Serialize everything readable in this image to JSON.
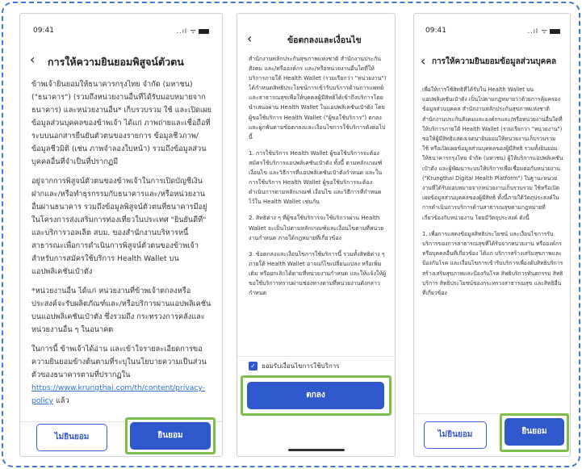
{
  "screen1": {
    "time": "09:41",
    "signal": "..ıl ᯤ",
    "title": "การให้ความยินยอมพิสูจน์ตัวตน",
    "paragraphs": [
      "ข้าพเจ้ายินยอมให้ธนาคารกรุงไทย จำกัด (มหาชน) (\"ธนาคาร\") (รวมถึงหน่วยงานอื่นที่ได้รับมอบหมายจากธนาคาร) และหน่วยงานอื่น* เก็บรวบรวม ใช้ และเปิดเผยข้อมูลส่วนบุคคลของข้าพเจ้า ได้แก่ ภาพถ่ายและเชื่อถือที่ระบบนอกสารยืนยันตัวตนของรายการ ข้อมูลชีวภาพ/ข้อมูลชีวมิติ (เช่น ภาพจำลองใบหน้า) รวมถึงข้อมูลส่วนบุคคลอื่นที่จำเป็นที่ปรากฏมี",
      "อยู่จากการพิสูจน์ตัวตนของข้าพเจ้าในการเปิดบัญชีเงินฝากและ/หรือทำธุรกรรมกับธนาคารและ/หรือหน่วยงานอื่นผ่านธนาคาร รวมถึงข้อมูลพิสูจน์ตัวตนที่ธนาคารมีอยู่ในโครงการส่งเสริมการท่องเที่ยวในประเทศ \"ยินยันดีที่\" และบริการวอลเล็ต สบม. ของสำนักงานบริหารหนี้สาธารณะเพื่อการดำเนินการพิสูจน์ตัวตนของข้าพเจ้าสำหรับการสมัครใช้บริการ Health Wallet บนแอปพลิเคชันเป๋าตัง",
      "*หน่วยงานอื่น ได้แก่ หน่วยงานที่ข้าพเจ้าตกลงหรือประสงค์จะรับผลิตภัณฑ์และ/หรือบริการผ่านแอปพลิเคชันบนแอปพลิเคชันเป๋าตัง ซึ่งรวมถึง กระทรวงการคลังและหน่วยงานอื่น ๆ ในอนาคต",
      "ในการนี้ ข้าพเจ้าได้อ่าน และเข้าใจรายละเอียดการขอความยินยอมข้างต้นตามที่ระบุในนโยบายความเป็นส่วนตัวของธนาคารตามที่ปรากฏใน"
    ],
    "link": "https://www.krungthai.com/th/content/privacy-policy",
    "link_suffix": " แล้ว",
    "decline_label": "ไม่ยินยอม",
    "accept_label": "ยินยอม"
  },
  "screen2": {
    "title": "ข้อตกลงและเงื่อนไข",
    "paragraphs": [
      "สำนักงานหลักประกันสุขภาพแห่งชาติ สำนักงานประกันสังคม และ/หรือองค์กร และ/หรือหน่วยงานอื่นใดที่ให้บริการภายใต้ Health Wallet (รวมเรียกว่า \"หน่วยงาน\") ได้กำหนดสิทธิประโยชน์การเข้ารับบริการด้านการแพทย์และสาธารณสุขเพื่อให้บุคคลผู้มีสิทธิได้เข้าถึงบริการโดยนำเสนอผ่าน Health Wallet ในแอปพลิเคชันเป๋าตัง โดยผู้ขอใช้บริการ Health Wallet (\"ผู้ขอใช้บริการ\") ตกลงและผูกพันตามข้อตกลงและเงื่อนไขการใช้บริการดังต่อไปนี้",
      "1. การใช้บริการ Health Wallet ผู้ขอใช้บริการจะต้องสมัครใช้บริการแอปพลิเคชันเป๋าตัง ทั้งนี้ ตามหลักเกณฑ์ เงื่อนไข และวิธีการที่แอปพลิเคชันเป๋าตังกำหนด และในการใช้บริการ Health Wallet ผู้ขอใช้บริการจะต้องดำเนินการตามหลักเกณฑ์ เงื่อนไข และวิธีการที่กำหนดไว้ใน Health Wallet เช่นกัน",
      "2. สิทธิต่าง ๆ ที่ผู้ขอใช้บริการจะใช้บริการผ่าน Health Wallet จะเป็นไปตามหลักเกณฑ์และเงื่อนไขตามที่หน่วยงานกำหนด ภายใต้กฎหมายที่เกี่ยวข้อง",
      "3. ข้อตกลงและเงื่อนไขการใช้บริการนี้ รวมทั้งสิทธิต่าง ๆ ภายใต้ Health Wallet อาจแก้ไขเปลี่ยนแปลง หรือเพิ่มเติม หรือยกเลิกได้ตามที่หน่วยงานกำหนด และให้แจ้งให้ผู้ขอใช้บริการทราบผ่านช่องทางตามที่หน่วยงานดังกล่าวกำหนด"
    ],
    "consent_label": "ยอมรับเงื่อนไขการใช้บริการ",
    "ok_label": "ตกลง"
  },
  "screen3": {
    "time": "09:41",
    "signal": "..ıl ᯤ",
    "title": "การให้ความยินยอมข้อมูลส่วนบุคคล",
    "paragraphs": [
      "เพื่อให้การใช้สิทธิที่ได้รับใน Health Wallet บนแอปพลิเคชันเป๋าตัง เป็นไปตามกฎหมายว่าด้วยการคุ้มครองข้อมูลส่วนบุคคล สำนักงานหลักประกันสุขภาพแห่งชาติ สำนักงานประกันสังคมและองค์กรและ/หรือหน่วยงานอื่นใดที่ให้บริการภายใต้ Health Wallet (รวมเรียกว่า \"หน่วยงาน\") ขอให้ผู้มีสิทธิแสดงเจตนายินยอมให้หน่วยงานเก็บรวบรวม ใช้ หรือเปิดเผยข้อมูลส่วนบุคคลของผู้มีสิทธิ รวมทั้งยินยอมให้ธนาคารกรุงไทย จำกัด (มหาชน) ผู้ให้บริการแอปพลิเคชันเป๋าตัง และผู้พัฒนาระบบให้บริการเพื่อเชื่อมต่อกับหน่วยงาน (\"Krungthai Digital Health Platform\") ในฐานะหน่วยงานที่ได้รับมอบหมายจากหน่วยงานเก็บรวบรวม ใช้หรือเปิดเผยข้อมูลส่วนบุคคลของผู้มีสิทธิ ทั้งนี้ภายใต้วัตถุประสงค์ในการดำเนินการบริการด้านสาธารณสุขตามกฎหมายที่เกี่ยวข้องกับหน่วยงาน โดยมีวัตถุประสงค์ ดังนี้",
      "1. เพื่อการแสดงข้อมูลสิทธิประโยชน์ และเงื่อนไขการรับบริการของการสาธารณสุขที่ได้รับจากหน่วยงาน หรือองค์กรหรือบุคคลอื่นที่เกี่ยวข้อง ได้แก่ บริการสร้างเสริมสุขภาพและป้องกันโรค และเงื่อนไขการเข้ารับบริการเพื่องดับสิทธิบริการสร้างเสริมสุขภาพและป้องกันโรค สิทธิบริการทันตกรรม สิทธิบริการ สิทธิประโยชน์ของกระทรวงสาธารณสุข และสิทธิอื่นที่เกี่ยวข้อง"
    ],
    "decline_label": "ไม่ยินยอม",
    "accept_label": "ยินยอม"
  }
}
